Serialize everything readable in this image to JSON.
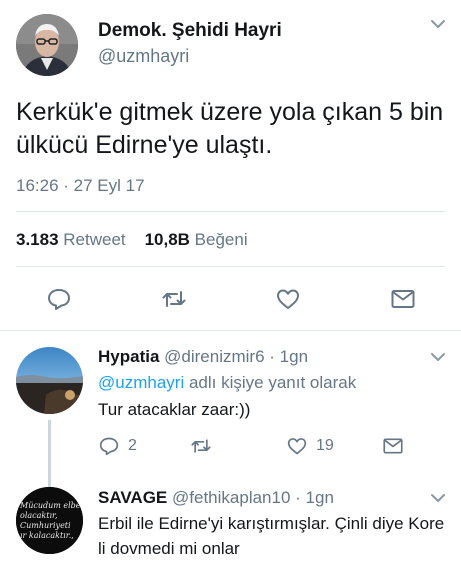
{
  "tweet": {
    "author_name": "Demok. Şehidi Hayri",
    "author_handle": "@uzmhayri",
    "text": "Kerkük'e gitmek üzere yola çıkan 5 bin ülkücü Edirne'ye ulaştı.",
    "timestamp": "16:26 · 27 Eyl 17",
    "retweet_count": "3.183",
    "retweet_label": "Retweet",
    "like_count": "10,8B",
    "like_label": "Beğeni"
  },
  "replies": [
    {
      "name": "Hypatia",
      "handle": "@direnizmir6",
      "time": "· 1gn",
      "reply_to_mention": "@uzmhayri",
      "reply_to_suffix": " adlı kişiye yanıt olarak",
      "text": "Tur atacaklar zaar:))",
      "reply_count": "2",
      "like_count": "19"
    },
    {
      "name": "SAVAGE",
      "handle": "@fethikaplan10",
      "time": "· 1gn",
      "text": "Erbil ile Edirne'yi karıştırmışlar. Çinli diye Kore li dovmedi mi onlar",
      "avatar_text": [
        "Mücudum elbet",
        "olacaktır,",
        "Cumhuriyeti",
        "ır kalacaktır.,"
      ]
    }
  ],
  "colors": {
    "accent": "#1da1f2",
    "secondary_text": "#657786",
    "divider": "#e1e8ed",
    "icon": "#657786"
  },
  "icons": [
    "chevron-down-icon",
    "reply-icon",
    "retweet-icon",
    "like-icon",
    "message-icon"
  ]
}
